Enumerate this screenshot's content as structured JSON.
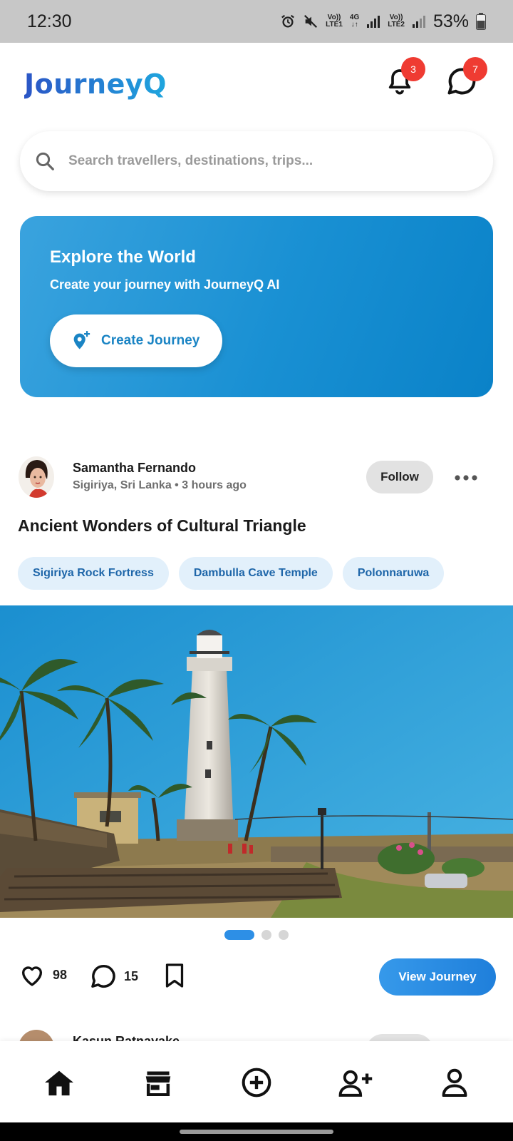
{
  "status_bar": {
    "time": "12:30",
    "sim1_top": "Vo))",
    "sim1_bottom": "LTE1",
    "net_top": "4G",
    "sim2_top": "Vo))",
    "sim2_bottom": "LTE2",
    "battery": "53%"
  },
  "header": {
    "logo": "JourneyQ",
    "notifications_count": "3",
    "messages_count": "7"
  },
  "search": {
    "placeholder": "Search travellers, destinations, trips..."
  },
  "banner": {
    "title": "Explore the World",
    "subtitle": "Create your journey with JourneyQ AI",
    "button_label": "Create Journey"
  },
  "post": {
    "author": "Samantha Fernando",
    "meta": "Sigiriya, Sri Lanka • 3 hours ago",
    "follow_label": "Follow",
    "title": "Ancient Wonders of Cultural Triangle",
    "tags": [
      "Sigiriya Rock Fortress",
      "Dambulla Cave Temple",
      "Polonnaruwa"
    ],
    "likes": "98",
    "comments": "15",
    "view_label": "View Journey",
    "image_index": 0,
    "image_count": 3
  },
  "next_post": {
    "author": "Kasun Ratnayake"
  },
  "colors": {
    "accent": "#1a84c4",
    "badge": "#ef3b32",
    "banner_start": "#3aa3de",
    "banner_end": "#0a82c8",
    "tag_bg": "#e2f0fb"
  },
  "icons": {
    "notifications": "bell-icon",
    "messages": "chat-bubble-icon",
    "search": "search-icon",
    "create": "add-location-icon",
    "like": "heart-icon",
    "comment": "comment-icon",
    "save": "bookmark-icon",
    "nav": [
      "home-icon",
      "store-icon",
      "add-circle-icon",
      "add-friend-icon",
      "profile-icon"
    ]
  }
}
